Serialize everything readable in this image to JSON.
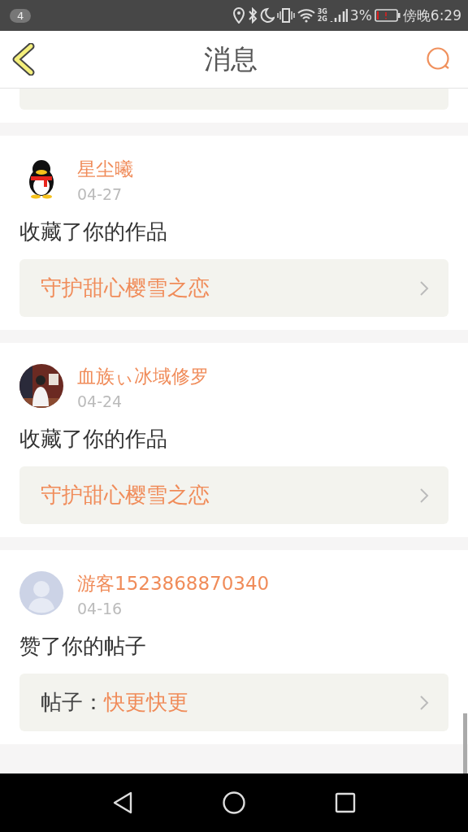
{
  "status_bar": {
    "notification_count": "4",
    "network_top": "3G",
    "network_bottom": "2G",
    "battery": "3%",
    "time": "傍晚6:29"
  },
  "header": {
    "title": "消息"
  },
  "messages": [
    {
      "kind": "work",
      "avatar": {
        "kind": "penguin"
      },
      "name": "星尘曦",
      "date": "04-27",
      "action": "收藏了你的作品",
      "title": "守护甜心樱雪之恋"
    },
    {
      "kind": "work",
      "name": "血族ぃ冰域修罗",
      "date": "04-24",
      "action": "收藏了你的作品",
      "title": "守护甜心樱雪之恋"
    },
    {
      "kind": "post",
      "avatar": {
        "kind": "default"
      },
      "name": "游客1523868870340",
      "date": "04-16",
      "action": "赞了你的帖子",
      "label": "帖子：",
      "title": "快更快更"
    }
  ]
}
